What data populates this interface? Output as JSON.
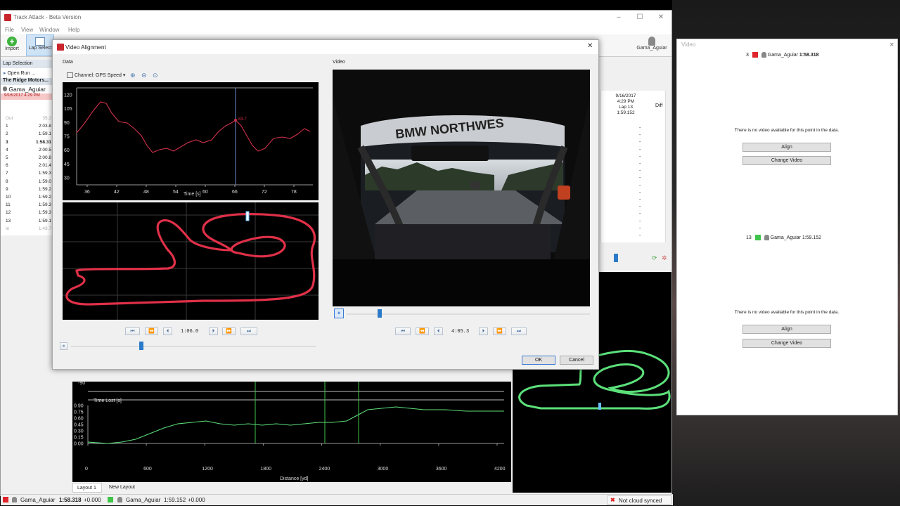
{
  "app": {
    "title": "Track Attack - Beta Version",
    "menu": [
      "File",
      "View",
      "Window",
      "Help"
    ],
    "toolbar": {
      "import": "Import",
      "lap_select": "Lap Select",
      "user": "Gama_Aguiar"
    }
  },
  "lap_panel": {
    "header": "Lap Selection",
    "open_run": "Open Run ...",
    "track": "The Ridge Motors...",
    "driver": "Gama_Aguiar",
    "date": "9/16/2017 4:29 PM",
    "laps": [
      {
        "n": "Out",
        "v": "35.2"
      },
      {
        "n": "1",
        "v": "2:03.8"
      },
      {
        "n": "2",
        "v": "1:59.1"
      },
      {
        "n": "3",
        "v": "1:58.31"
      },
      {
        "n": "4",
        "v": "2:00.5"
      },
      {
        "n": "5",
        "v": "2:00.8"
      },
      {
        "n": "6",
        "v": "2:01.4"
      },
      {
        "n": "7",
        "v": "1:59.3"
      },
      {
        "n": "8",
        "v": "1:59.0"
      },
      {
        "n": "9",
        "v": "1:59.2"
      },
      {
        "n": "10",
        "v": "1:59.2"
      },
      {
        "n": "11",
        "v": "1:59.3"
      },
      {
        "n": "12",
        "v": "1:59.3"
      },
      {
        "n": "13",
        "v": "1:59.1"
      },
      {
        "n": "In",
        "v": "1:43.7"
      }
    ]
  },
  "rtable": {
    "date": "9/16/2017",
    "time": "4:29 PM",
    "lap": "Lap 13",
    "laptime": "1:59.152",
    "diff": "Diff",
    "dash": "-"
  },
  "dialog": {
    "title": "Video Alignment",
    "data_label": "Data",
    "video_label": "Video",
    "channel": "Channel: GPS Speed",
    "data_time": "1:06.0",
    "video_time": "4:05.3",
    "ok": "OK",
    "cancel": "Cancel",
    "cursor_value": "83.7"
  },
  "speed_chart": {
    "x_ticks": [
      "36",
      "42",
      "48",
      "54",
      "60",
      "66",
      "72",
      "78"
    ],
    "y_ticks": [
      "120",
      "105",
      "90",
      "75",
      "60",
      "45",
      "30"
    ],
    "xlabel": "Time [s]"
  },
  "timelost_chart": {
    "label": "Time Lost [s]",
    "y_ticks": [
      "0.90",
      "0.75",
      "0.60",
      "0.45",
      "0.30",
      "0.15",
      "0.00"
    ],
    "x_ticks": [
      "0",
      "600",
      "1200",
      "1800",
      "2400",
      "3000",
      "3600",
      "4200"
    ],
    "xlabel": "Distance [yd]",
    "top_tick": "-90"
  },
  "layout_tabs": [
    "Layout 1",
    "New Layout"
  ],
  "status": {
    "lap1_driver": "Gama_Aguiar",
    "lap1_time": "1:58.318",
    "lap1_delta": "+0.000",
    "lap2_driver": "Gama_Aguiar",
    "lap2_time": "1:59.152",
    "lap2_delta": "+0.000",
    "cloud": "Not cloud synced"
  },
  "video_panel": {
    "title": "Video",
    "slot1": {
      "lap": "3",
      "driver": "Gama_Aguiar",
      "time": "1:58.318",
      "color": "#e0242b"
    },
    "slot2": {
      "lap": "13",
      "driver": "Gama_Aguiar",
      "time": "1:59.152",
      "color": "#3fc44a"
    },
    "no_video": "There is no video available for this point in the data.",
    "align": "Align",
    "change": "Change Video"
  },
  "colors": {
    "lap_red": "#e0242b",
    "lap_green": "#3fc44a",
    "accent": "#2a7ac9"
  }
}
